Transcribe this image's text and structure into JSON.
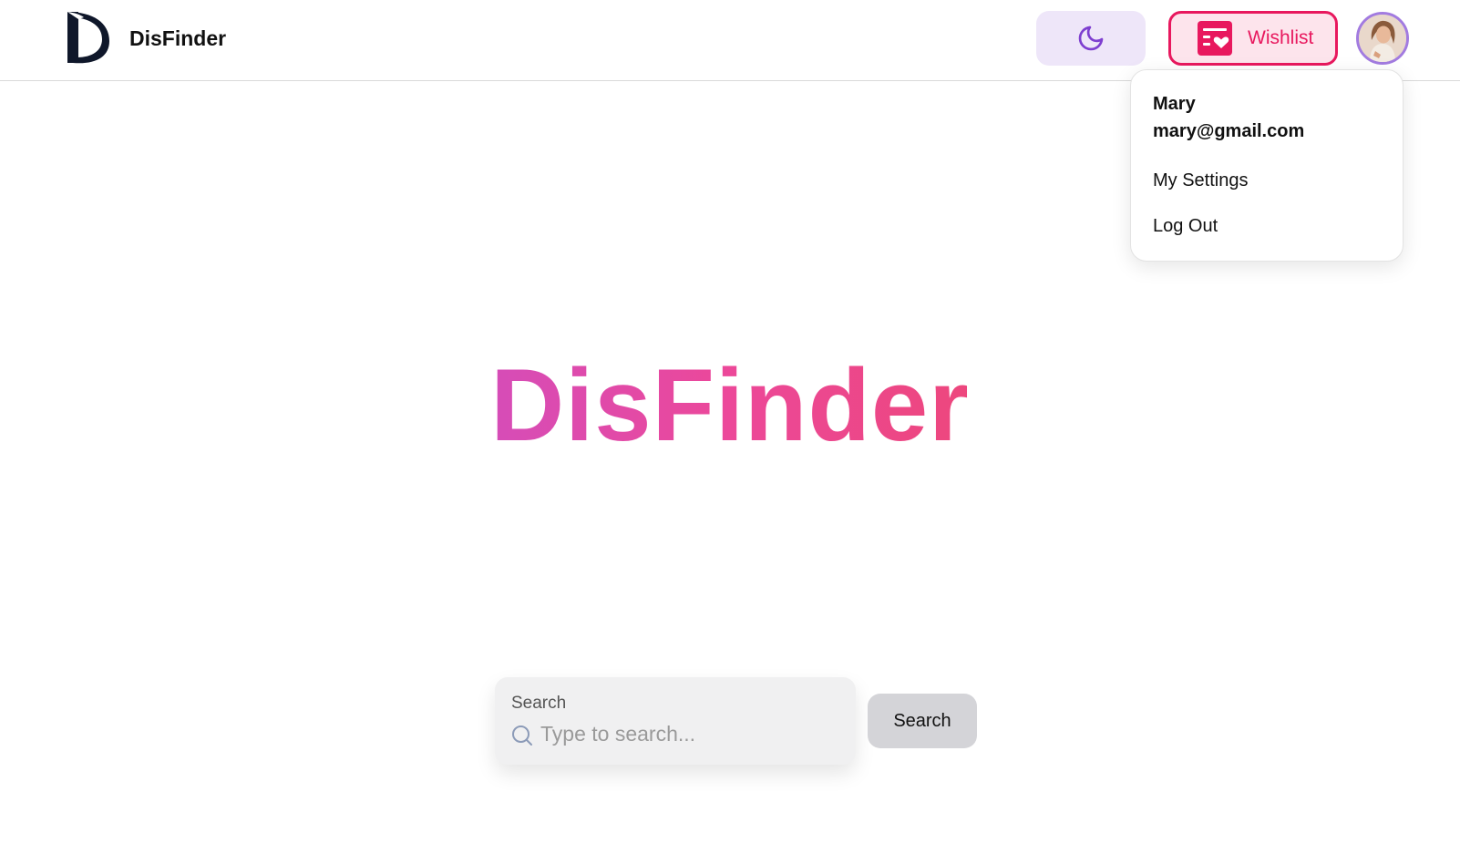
{
  "header": {
    "brand_name": "DisFinder",
    "wishlist_label": "Wishlist"
  },
  "user_menu": {
    "name": "Mary",
    "email": "mary@gmail.com",
    "items": [
      "My Settings",
      "Log Out"
    ]
  },
  "hero": {
    "title": "DisFinder"
  },
  "search": {
    "label": "Search",
    "placeholder": "Type to search...",
    "button_label": "Search"
  },
  "icons": {
    "theme_toggle": "moon-icon",
    "wishlist": "wishlist-heart-icon",
    "search": "search-icon"
  },
  "colors": {
    "wishlist_accent": "#e8185e",
    "theme_toggle_bg": "#eee6f9",
    "moon_icon": "#7e3fd0",
    "avatar_ring": "#a27be0",
    "hero_gradient": [
      "#a855f7",
      "#ec4899",
      "#ef4444"
    ],
    "search_button_bg": "#d4d4d8"
  }
}
